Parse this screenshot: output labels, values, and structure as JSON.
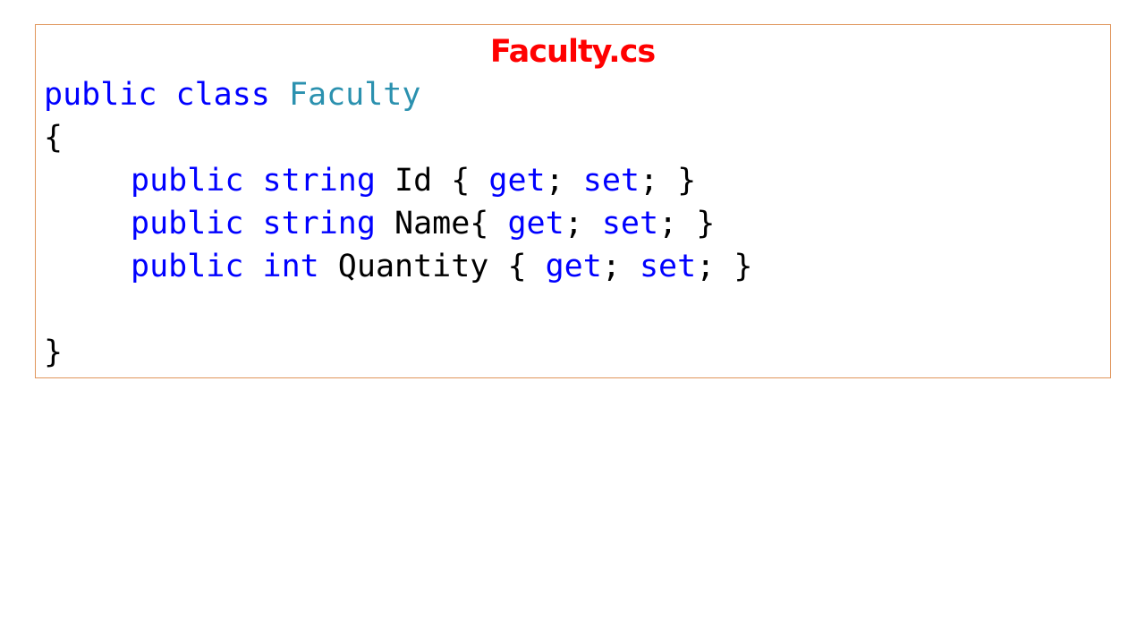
{
  "title": "Faculty.cs",
  "colors": {
    "title": "#ff0000",
    "keyword": "#0000ff",
    "type_name": "#2b91af",
    "plain": "#000000",
    "box_border": "#e0955b"
  },
  "code_lines": [
    {
      "indent": false,
      "tokens": [
        {
          "text": "public",
          "kind": "keyword"
        },
        {
          "text": " ",
          "kind": "plain"
        },
        {
          "text": "class",
          "kind": "keyword"
        },
        {
          "text": " ",
          "kind": "plain"
        },
        {
          "text": "Faculty",
          "kind": "type_name"
        }
      ]
    },
    {
      "indent": false,
      "tokens": [
        {
          "text": "{",
          "kind": "plain"
        }
      ]
    },
    {
      "indent": true,
      "tokens": [
        {
          "text": "public",
          "kind": "keyword"
        },
        {
          "text": " ",
          "kind": "plain"
        },
        {
          "text": "string",
          "kind": "keyword"
        },
        {
          "text": " Id { ",
          "kind": "plain"
        },
        {
          "text": "get",
          "kind": "keyword"
        },
        {
          "text": "; ",
          "kind": "plain"
        },
        {
          "text": "set",
          "kind": "keyword"
        },
        {
          "text": "; }",
          "kind": "plain"
        }
      ]
    },
    {
      "indent": true,
      "tokens": [
        {
          "text": "public",
          "kind": "keyword"
        },
        {
          "text": " ",
          "kind": "plain"
        },
        {
          "text": "string",
          "kind": "keyword"
        },
        {
          "text": " Name{ ",
          "kind": "plain"
        },
        {
          "text": "get",
          "kind": "keyword"
        },
        {
          "text": "; ",
          "kind": "plain"
        },
        {
          "text": "set",
          "kind": "keyword"
        },
        {
          "text": "; }",
          "kind": "plain"
        }
      ]
    },
    {
      "indent": true,
      "tokens": [
        {
          "text": "public",
          "kind": "keyword"
        },
        {
          "text": " ",
          "kind": "plain"
        },
        {
          "text": "int",
          "kind": "keyword"
        },
        {
          "text": " Quantity { ",
          "kind": "plain"
        },
        {
          "text": "get",
          "kind": "keyword"
        },
        {
          "text": "; ",
          "kind": "plain"
        },
        {
          "text": "set",
          "kind": "keyword"
        },
        {
          "text": "; }",
          "kind": "plain"
        }
      ]
    },
    {
      "indent": false,
      "tokens": []
    },
    {
      "indent": false,
      "tokens": [
        {
          "text": "}",
          "kind": "plain"
        }
      ]
    }
  ]
}
